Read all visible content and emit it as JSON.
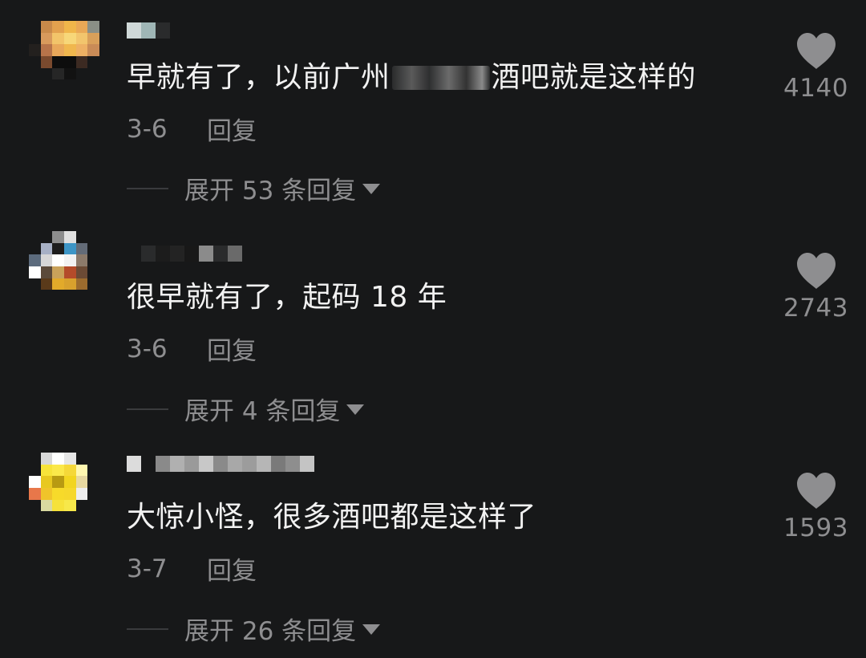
{
  "comments": [
    {
      "text_before": "早就有了，以前广州",
      "text_after": "酒吧就是这样的",
      "text": "",
      "date": "3-6",
      "reply_label": "回复",
      "expand_label": "展开 53 条回复",
      "likes": "4140",
      "avatar_colors": [
        "#171819",
        "#c98a4a",
        "#e3a14e",
        "#f0b64a",
        "#e9a856",
        "#8a8f86",
        "#171819",
        "#d89a5c",
        "#f2c46a",
        "#f7d779",
        "#f2c56d",
        "#d9a05a",
        "#23201e",
        "#b7744a",
        "#e8a75a",
        "#f0b74e",
        "#eeb064",
        "#c98b57",
        "#171819",
        "#7a4a2e",
        "#0d0d0d",
        "#0d0d0d",
        "#3c2a22",
        "#171819",
        "#171819",
        "#171819",
        "#262626",
        "#121212",
        "#171819",
        "#171819",
        "#171819",
        "#171819",
        "#171819",
        "#171819",
        "#171819",
        "#171819"
      ],
      "name_colors": [
        "#cfd8d8",
        "#9fb6b6",
        "#2a2b2c"
      ]
    },
    {
      "text_before": "",
      "text_after": "",
      "text": "很早就有了，起码 18 年",
      "date": "3-6",
      "reply_label": "回复",
      "expand_label": "展开 4 条回复",
      "likes": "2743",
      "avatar_colors": [
        "#171819",
        "#171819",
        "#8d8d8d",
        "#e0e0e0",
        "#171819",
        "#171819",
        "#171819",
        "#a7b0c5",
        "#1d1d1d",
        "#3d95c6",
        "#636b77",
        "#171819",
        "#5c6b7d",
        "#d6d6d6",
        "#ffffff",
        "#f2f2f2",
        "#8c7a6a",
        "#171819",
        "#ffffff",
        "#5b4a3a",
        "#c9a25a",
        "#b44b2a",
        "#6b4a35",
        "#171819",
        "#171819",
        "#5a3a1a",
        "#e2aa2a",
        "#d8a12d",
        "#9b6b2e",
        "#171819",
        "#171819",
        "#171819",
        "#171819",
        "#171819",
        "#171819",
        "#171819"
      ],
      "name_colors": [
        "#171819",
        "#2a2b2c",
        "#1c1c1c",
        "#232323",
        "#181818",
        "#8b8b8b",
        "#2a2b2c",
        "#6a6a6a"
      ]
    },
    {
      "text_before": "",
      "text_after": "",
      "text": "大惊小怪，很多酒吧都是这样了",
      "date": "3-7",
      "reply_label": "回复",
      "expand_label": "展开 26 条回复",
      "likes": "1593",
      "avatar_colors": [
        "#171819",
        "#d8d8d8",
        "#ffffff",
        "#e6e6e6",
        "#171819",
        "#171819",
        "#171819",
        "#f7e33a",
        "#fbe84a",
        "#f5d839",
        "#fff7b0",
        "#171819",
        "#ffffff",
        "#e8c820",
        "#b89a12",
        "#f2d520",
        "#e7d8a0",
        "#171819",
        "#e8774a",
        "#f0c42a",
        "#f7da2a",
        "#f6d82c",
        "#eeeeee",
        "#171819",
        "#171819",
        "#d9d9a0",
        "#f6e23a",
        "#f7e84a",
        "#171819",
        "#171819",
        "#171819",
        "#171819",
        "#171819",
        "#171819",
        "#171819",
        "#171819"
      ],
      "name_colors": [
        "#dcdcdc",
        "#171819",
        "#8a8a8a",
        "#b0b0b0",
        "#9a9a9a",
        "#c8c8c8",
        "#8a8a8a",
        "#a8a8a8",
        "#9c9c9c",
        "#b6b6b6",
        "#7a7a7a",
        "#8e8e8e",
        "#c4c4c4"
      ]
    }
  ]
}
